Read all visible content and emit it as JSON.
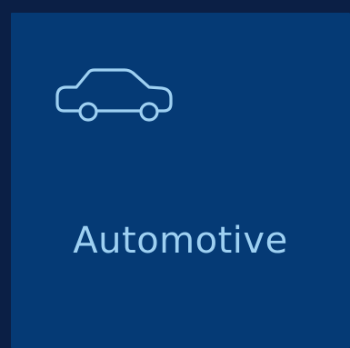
{
  "tile": {
    "icon": "car-icon",
    "label": "Automotive"
  },
  "colors": {
    "page_background": "#0b1f45",
    "tile_background": "#053a75",
    "accent": "#9ed0f2"
  }
}
